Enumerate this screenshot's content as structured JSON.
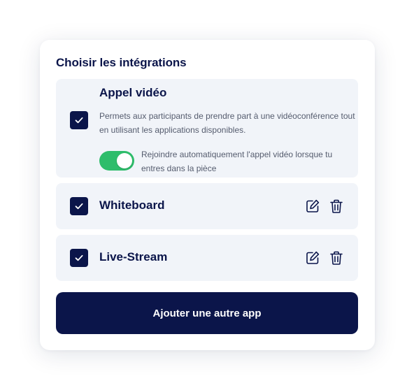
{
  "panel": {
    "title": "Choisir les intégrations"
  },
  "integrations": [
    {
      "name": "Appel vidéo",
      "checked": true,
      "description": "Permets aux participants de prendre part à une vidéoconférence tout en utilisant les applications disponibles.",
      "auto_join": {
        "enabled": true,
        "label": "Rejoindre automatiquement l'appel vidéo lorsque tu entres dans la pièce"
      }
    },
    {
      "name": "Whiteboard",
      "checked": true,
      "icons": [
        "edit-icon",
        "trash-icon"
      ]
    },
    {
      "name": "Live-Stream",
      "checked": true,
      "icons": [
        "edit-icon",
        "trash-icon"
      ]
    }
  ],
  "actions": {
    "add_app_label": "Ajouter une autre app"
  },
  "colors": {
    "primary": "#0b154a",
    "row_background": "#f1f4f9",
    "toggle_on": "#2ebd6b",
    "description_text": "#555c6e"
  }
}
